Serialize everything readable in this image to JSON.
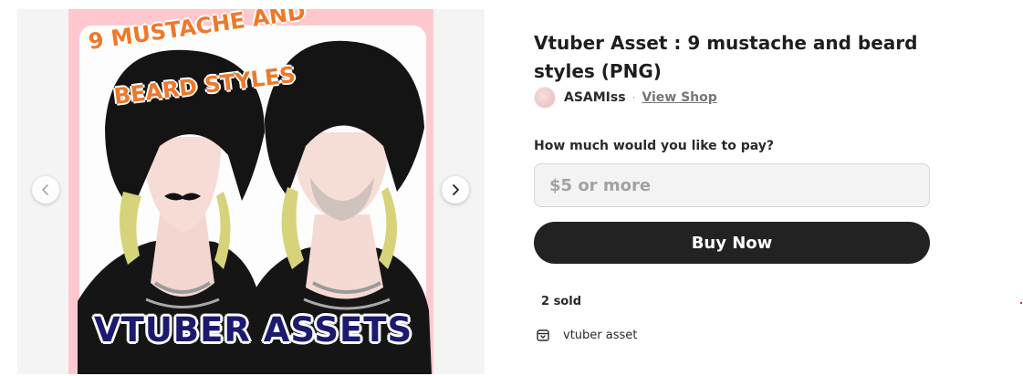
{
  "gallery": {
    "artwork": {
      "headline_line1": "9 MUSTACHE AND",
      "headline_line2": "BEARD STYLES",
      "caption": "VTUBER ASSETS"
    },
    "prev_icon": "chevron-left-icon",
    "next_icon": "chevron-right-icon"
  },
  "product": {
    "title": "Vtuber Asset : 9 mustache and beard styles (PNG)",
    "shop_name": "ASAMIss",
    "separator": "·",
    "view_shop_label": "View Shop",
    "pay_prompt": "How much would you like to pay?",
    "price_placeholder": "$5 or more",
    "price_value": "",
    "buy_label": "Buy Now",
    "sold_text": "2 sold",
    "category_icon": "box-icon",
    "category_label": "vtuber asset"
  },
  "colors": {
    "accent_button": "#222222",
    "art_background": "#ffc8cf",
    "headline_orange": "#f0782a",
    "caption_navy": "#1c1a6e"
  }
}
